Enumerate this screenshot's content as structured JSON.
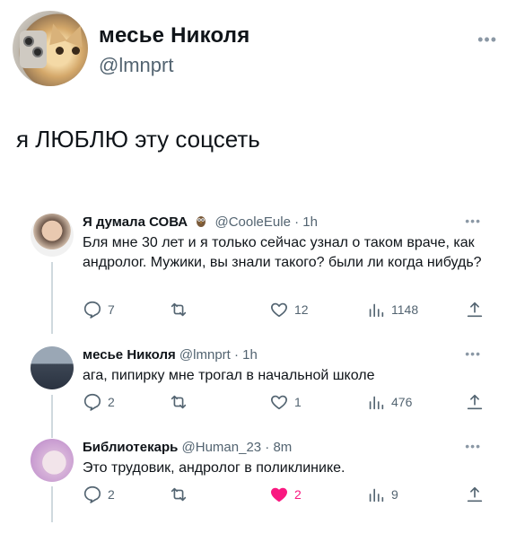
{
  "main_tweet": {
    "name": "месье Николя",
    "handle": "@lmnprt",
    "more_icon": "more-horizontal-icon",
    "text": "я ЛЮБЛЮ эту соцсеть"
  },
  "replies": [
    {
      "name": "Я думала СОВА",
      "emoji": "owl-emoji-icon",
      "meta": "@CooleEule · 1h",
      "text": "Бля мне 30 лет и я только сейчас узнал о таком враче, как андролог. Мужики, вы знали такого? были ли когда нибудь?",
      "replies": "7",
      "retweets": "",
      "likes": "12",
      "views": "1148",
      "liked": false
    },
    {
      "name": "месье Николя",
      "emoji": "",
      "meta": "@lmnprt · 1h",
      "text": "ага, пипирку мне трогал в начальной школе",
      "replies": "2",
      "retweets": "",
      "likes": "1",
      "views": "476",
      "liked": false
    },
    {
      "name": "Библиотекарь",
      "emoji": "",
      "meta": "@Human_23 · 8m",
      "text": "Это трудовик, андролог в поликлинике.",
      "replies": "2",
      "retweets": "",
      "likes": "2",
      "views": "9",
      "liked": true
    }
  ],
  "colors": {
    "text": "#0f1419",
    "secondary": "#536471",
    "like_active": "#f91880",
    "thread_line": "#cfd9de"
  }
}
